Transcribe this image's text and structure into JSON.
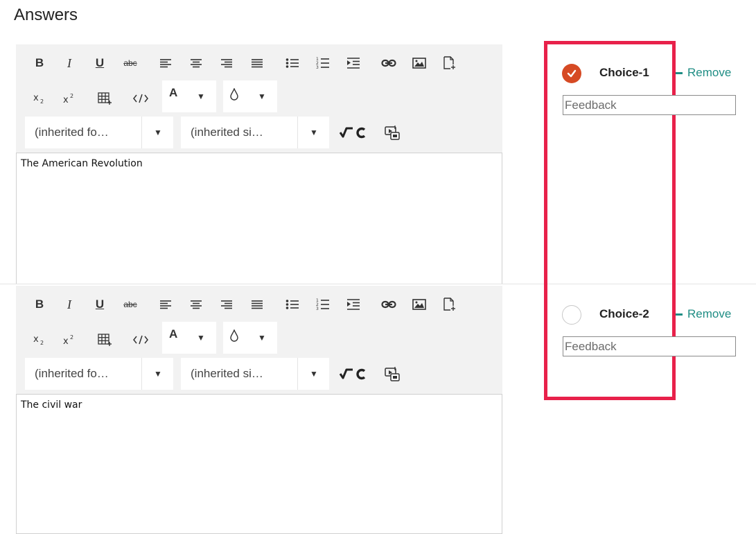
{
  "section_title": "Answers",
  "toolbar": {
    "bold": "B",
    "italic": "I",
    "underline": "U",
    "strikethrough": "abc",
    "text_color_letter": "A",
    "dropdown_arrow": "▼",
    "font_family": "(inherited fo…",
    "font_size": "(inherited si…"
  },
  "answers": [
    {
      "text": "The American Revolution",
      "choice_label": "Choice-1",
      "correct": true,
      "remove_label": "Remove",
      "feedback_placeholder": "Feedback"
    },
    {
      "text": "The civil war",
      "choice_label": "Choice-2",
      "correct": false,
      "remove_label": "Remove",
      "feedback_placeholder": "Feedback"
    }
  ],
  "colors": {
    "selected_radio": "#d64a24",
    "remove_link": "#1f8d84",
    "highlight_border": "#e8214a",
    "toolbar_bg": "#f2f2f2"
  }
}
